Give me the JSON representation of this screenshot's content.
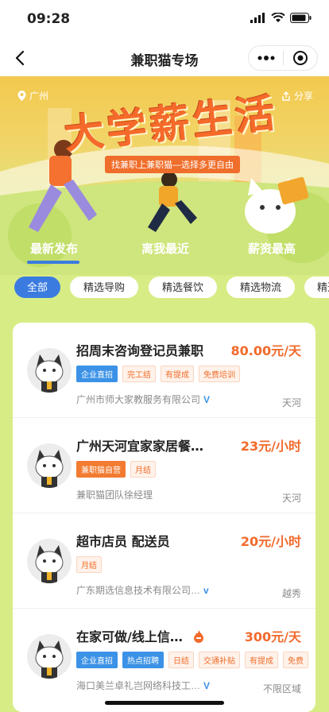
{
  "status": {
    "time": "09:28"
  },
  "nav": {
    "title": "兼职猫专场"
  },
  "banner": {
    "location": "广州",
    "share": "分享",
    "headline": "大学薪生活",
    "slogan": "找兼职上兼职猫—选择多更自由"
  },
  "tabs": [
    {
      "label": "最新发布",
      "active": true
    },
    {
      "label": "离我最近",
      "active": false
    },
    {
      "label": "薪资最高",
      "active": false
    }
  ],
  "filters": [
    {
      "label": "全部",
      "active": true
    },
    {
      "label": "精选导购",
      "active": false
    },
    {
      "label": "精选餐饮",
      "active": false
    },
    {
      "label": "精选物流",
      "active": false
    },
    {
      "label": "精选",
      "active": false
    }
  ],
  "jobs": [
    {
      "title": "招周末咨询登记员兼职",
      "salary": "80.00元/天",
      "tags": [
        "企业直招",
        "完工结",
        "有提成",
        "免费培训"
      ],
      "company": "广州市师大家教服务有限公司",
      "verified": "V",
      "area": "天河"
    },
    {
      "title": "广州天河宜家家居餐…",
      "salary": "23元/小时",
      "tags": [
        "兼职猫自营",
        "月结"
      ],
      "company": "兼职猫团队徐经理",
      "verified": "",
      "area": "天河"
    },
    {
      "title": "超市店员 配送员",
      "salary": "20元/小时",
      "tags": [
        "月结"
      ],
      "company": "广东期选信息技术有限公司…",
      "verified": "v",
      "area": "越秀"
    },
    {
      "title": "在家可做/线上信…",
      "salary": "300元/天",
      "tags": [
        "企业直招",
        "热点招聘",
        "日结",
        "交通补贴",
        "有提成",
        "免费"
      ],
      "company": "海口美兰卓礼岂网络科技工…",
      "verified": "V",
      "area": "不限区域"
    }
  ],
  "colors": {
    "accent": "#3b7be0",
    "salary": "#f26a2b",
    "banner_bg": "#d8ec86"
  }
}
